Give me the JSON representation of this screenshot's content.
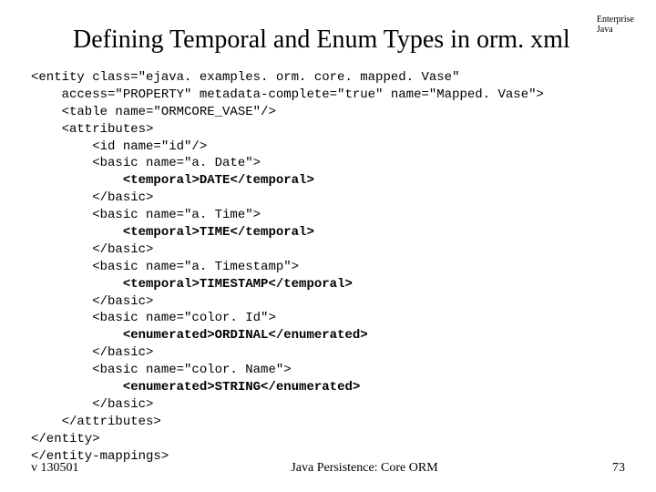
{
  "corner": {
    "line1": "Enterprise",
    "line2": "Java"
  },
  "title": "Defining Temporal and Enum Types in orm. xml",
  "code": {
    "l01": "<entity class=\"ejava. examples. orm. core. mapped. Vase\"",
    "l02": "    access=\"PROPERTY\" metadata-complete=\"true\" name=\"Mapped. Vase\">",
    "l03": "    <table name=\"ORMCORE_VASE\"/>",
    "l04": "    <attributes>",
    "l05": "        <id name=\"id\"/>",
    "l06": "        <basic name=\"a. Date\">",
    "l07a": "            ",
    "l07b": "<temporal>DATE</temporal>",
    "l08": "        </basic>",
    "l09": "        <basic name=\"a. Time\">",
    "l10a": "            ",
    "l10b": "<temporal>TIME</temporal>",
    "l11": "        </basic>",
    "l12": "        <basic name=\"a. Timestamp\">",
    "l13a": "            ",
    "l13b": "<temporal>TIMESTAMP</temporal>",
    "l14": "        </basic>",
    "l15": "        <basic name=\"color. Id\">",
    "l16a": "            ",
    "l16b": "<enumerated>ORDINAL</enumerated>",
    "l17": "        </basic>",
    "l18": "        <basic name=\"color. Name\">",
    "l19a": "            ",
    "l19b": "<enumerated>STRING</enumerated>",
    "l20": "        </basic>",
    "l21": "    </attributes>",
    "l22": "</entity>",
    "l23": "</entity-mappings>"
  },
  "footer": {
    "left": "v 130501",
    "center": "Java Persistence: Core ORM",
    "right": "73"
  }
}
